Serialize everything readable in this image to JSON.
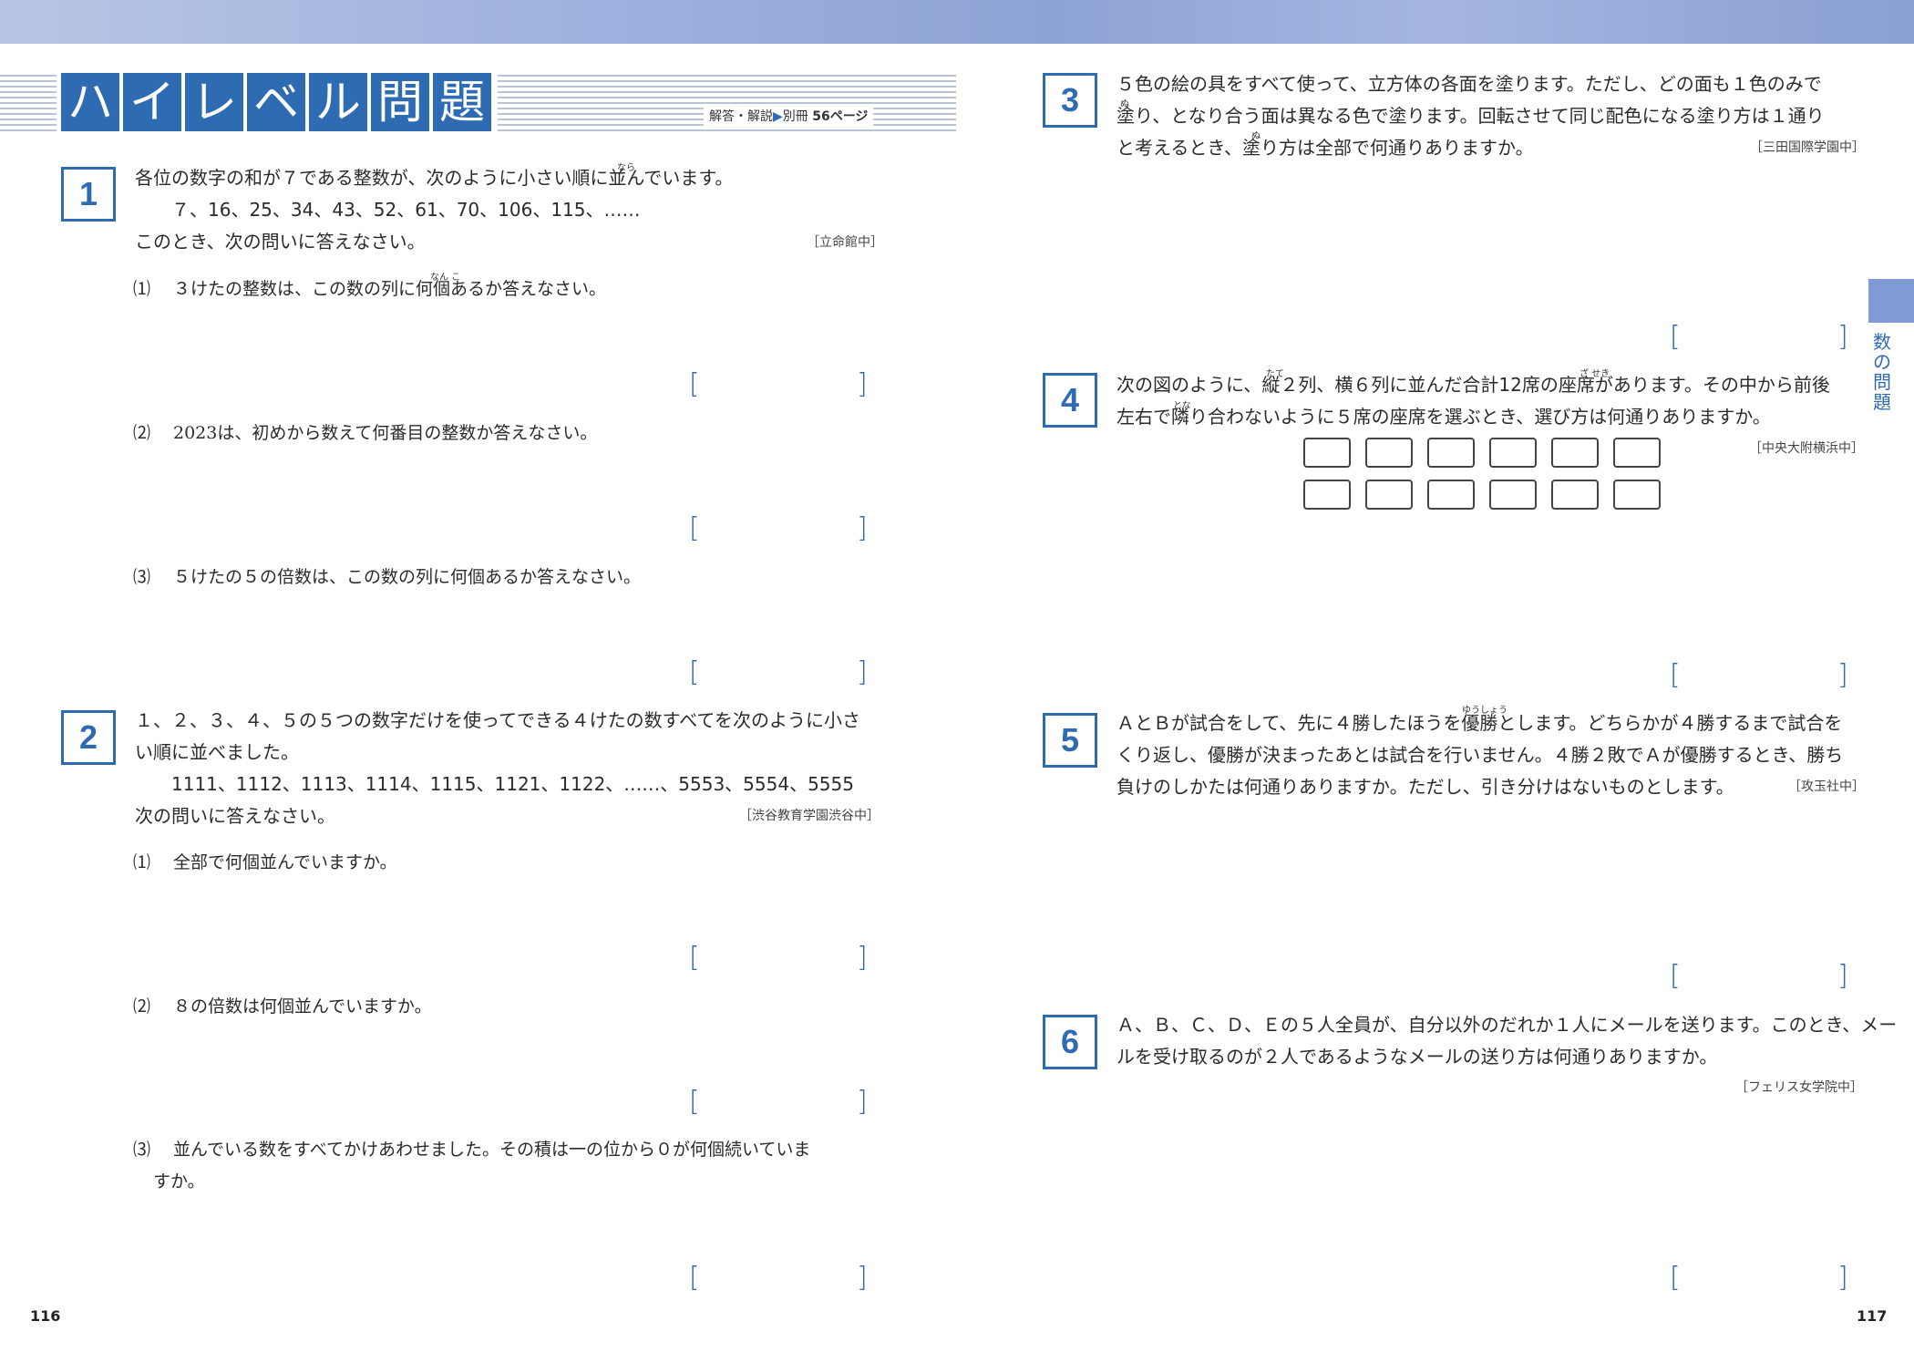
{
  "header": {
    "title_chars": [
      "ハ",
      "イ",
      "レ",
      "ベ",
      "ル",
      "問",
      "題"
    ],
    "reference_prefix": "解答・解説",
    "reference_arrow": "▶",
    "reference_book": "別冊",
    "reference_page": "56ページ"
  },
  "problems": [
    {
      "number": "1",
      "lines": [
        "各位の数字の和が７である整数が、次のように小さい順に並んでいます。",
        "　７、16、25、34、43、52、61、70、106、115、……",
        "このとき、次の問いに答えなさい。"
      ],
      "source": "［立命館中］",
      "ruby": [
        "なら",
        "なん こ"
      ],
      "subquestions": [
        {
          "label": "⑴",
          "text": "３けたの整数は、この数の列に何個あるか答えなさい。"
        },
        {
          "label": "⑵",
          "text": "2023は、初めから数えて何番目の整数か答えなさい。"
        },
        {
          "label": "⑶",
          "text": "５けたの５の倍数は、この数の列に何個あるか答えなさい。"
        }
      ]
    },
    {
      "number": "2",
      "lines": [
        "１、２、３、４、５の５つの数字だけを使ってできる４けたの数すべてを次のように小さ",
        "い順に並べました。",
        "　1111、1112、1113、1114、1115、1121、1122、……、5553、5554、5555",
        "次の問いに答えなさい。"
      ],
      "source": "［渋谷教育学園渋谷中］",
      "subquestions": [
        {
          "label": "⑴",
          "text": "全部で何個並んでいますか。"
        },
        {
          "label": "⑵",
          "text": "８の倍数は何個並んでいますか。"
        },
        {
          "label": "⑶",
          "text": "並んでいる数をすべてかけあわせました。その積は一の位から０が何個続いていま",
          "text2": "すか。"
        }
      ]
    },
    {
      "number": "3",
      "lines": [
        "５色の絵の具をすべて使って、立方体の各面を塗ります。ただし、どの面も１色のみで",
        "塗り、となり合う面は異なる色で塗ります。回転させて同じ配色になる塗り方は１通り",
        "と考えるとき、塗り方は全部で何通りありますか。"
      ],
      "source": "［三田国際学園中］",
      "ruby": [
        "ぬ",
        "ぬ"
      ]
    },
    {
      "number": "4",
      "lines": [
        "次の図のように、縦２列、横６列に並んだ合計12席の座席があります。その中から前後",
        "左右で隣り合わないように５席の座席を選ぶとき、選び方は何通りありますか。"
      ],
      "source": "［中央大附横浜中］",
      "ruby": [
        "たて",
        "ざ せき",
        "とな"
      ],
      "seat_rows": 2,
      "seat_cols": 6
    },
    {
      "number": "5",
      "lines": [
        "ＡとＢが試合をして、先に４勝したほうを優勝とします。どちらかが４勝するまで試合を",
        "くり返し、優勝が決まったあとは試合を行いません。４勝２敗でＡが優勝するとき、勝ち",
        "負けのしかたは何通りありますか。ただし、引き分けはないものとします。"
      ],
      "source": "［攻玉社中］",
      "ruby": [
        "ゆうしょう"
      ]
    },
    {
      "number": "6",
      "lines": [
        "Ａ、Ｂ、Ｃ、Ｄ、Ｅの５人全員が、自分以外のだれか１人にメールを送ります。このとき、メー",
        "ルを受け取るのが２人であるようなメールの送り方は何通りありますか。"
      ],
      "source": "［フェリス女学院中］"
    }
  ],
  "bracket": {
    "open": "[",
    "close": "]"
  },
  "side_label": "数の問題",
  "page_numbers": {
    "left": "116",
    "right": "117"
  },
  "colors": {
    "accent": "#2f6bb3",
    "band": "#8ea4d6",
    "tab": "#7f9bd3"
  }
}
